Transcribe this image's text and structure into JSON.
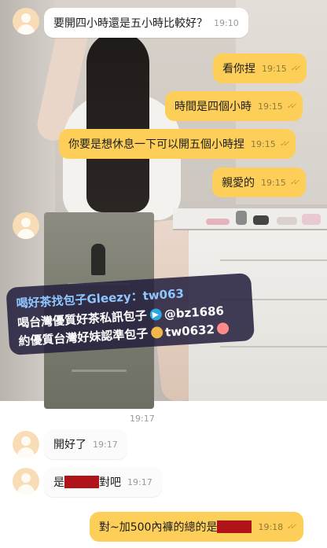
{
  "messages": [
    {
      "text": "要開四小時還是五小時比較好？",
      "time": "19:10"
    },
    {
      "text": "看你捏",
      "time": "19:15"
    },
    {
      "text": "時間是四個小時",
      "time": "19:15"
    },
    {
      "text": "你要是想休息一下可以開五個小時捏",
      "time": "19:15"
    },
    {
      "text": "親愛的",
      "time": "19:15"
    },
    {
      "image_time": "19:17"
    },
    {
      "text": "開好了",
      "time": "19:17"
    },
    {
      "text_before": "是",
      "text_after": "對吧",
      "time": "19:17"
    },
    {
      "text_before": "對~加500內褲的總的是",
      "time": "19:18"
    }
  ],
  "banner": {
    "line1": "喝好茶找包子Gleezy：tw063",
    "line2": "喝台灣優質好茶私訊包子",
    "line2_handle": "@bz1686",
    "line3": "約優質台灣好妹認準包子",
    "line3_handle": "tw0632"
  },
  "colors": {
    "outgoing_bubble": "#fdcf58",
    "incoming_bubble": "#ffffff",
    "avatar": "#f8dcb5",
    "redaction": "#b1131a"
  }
}
